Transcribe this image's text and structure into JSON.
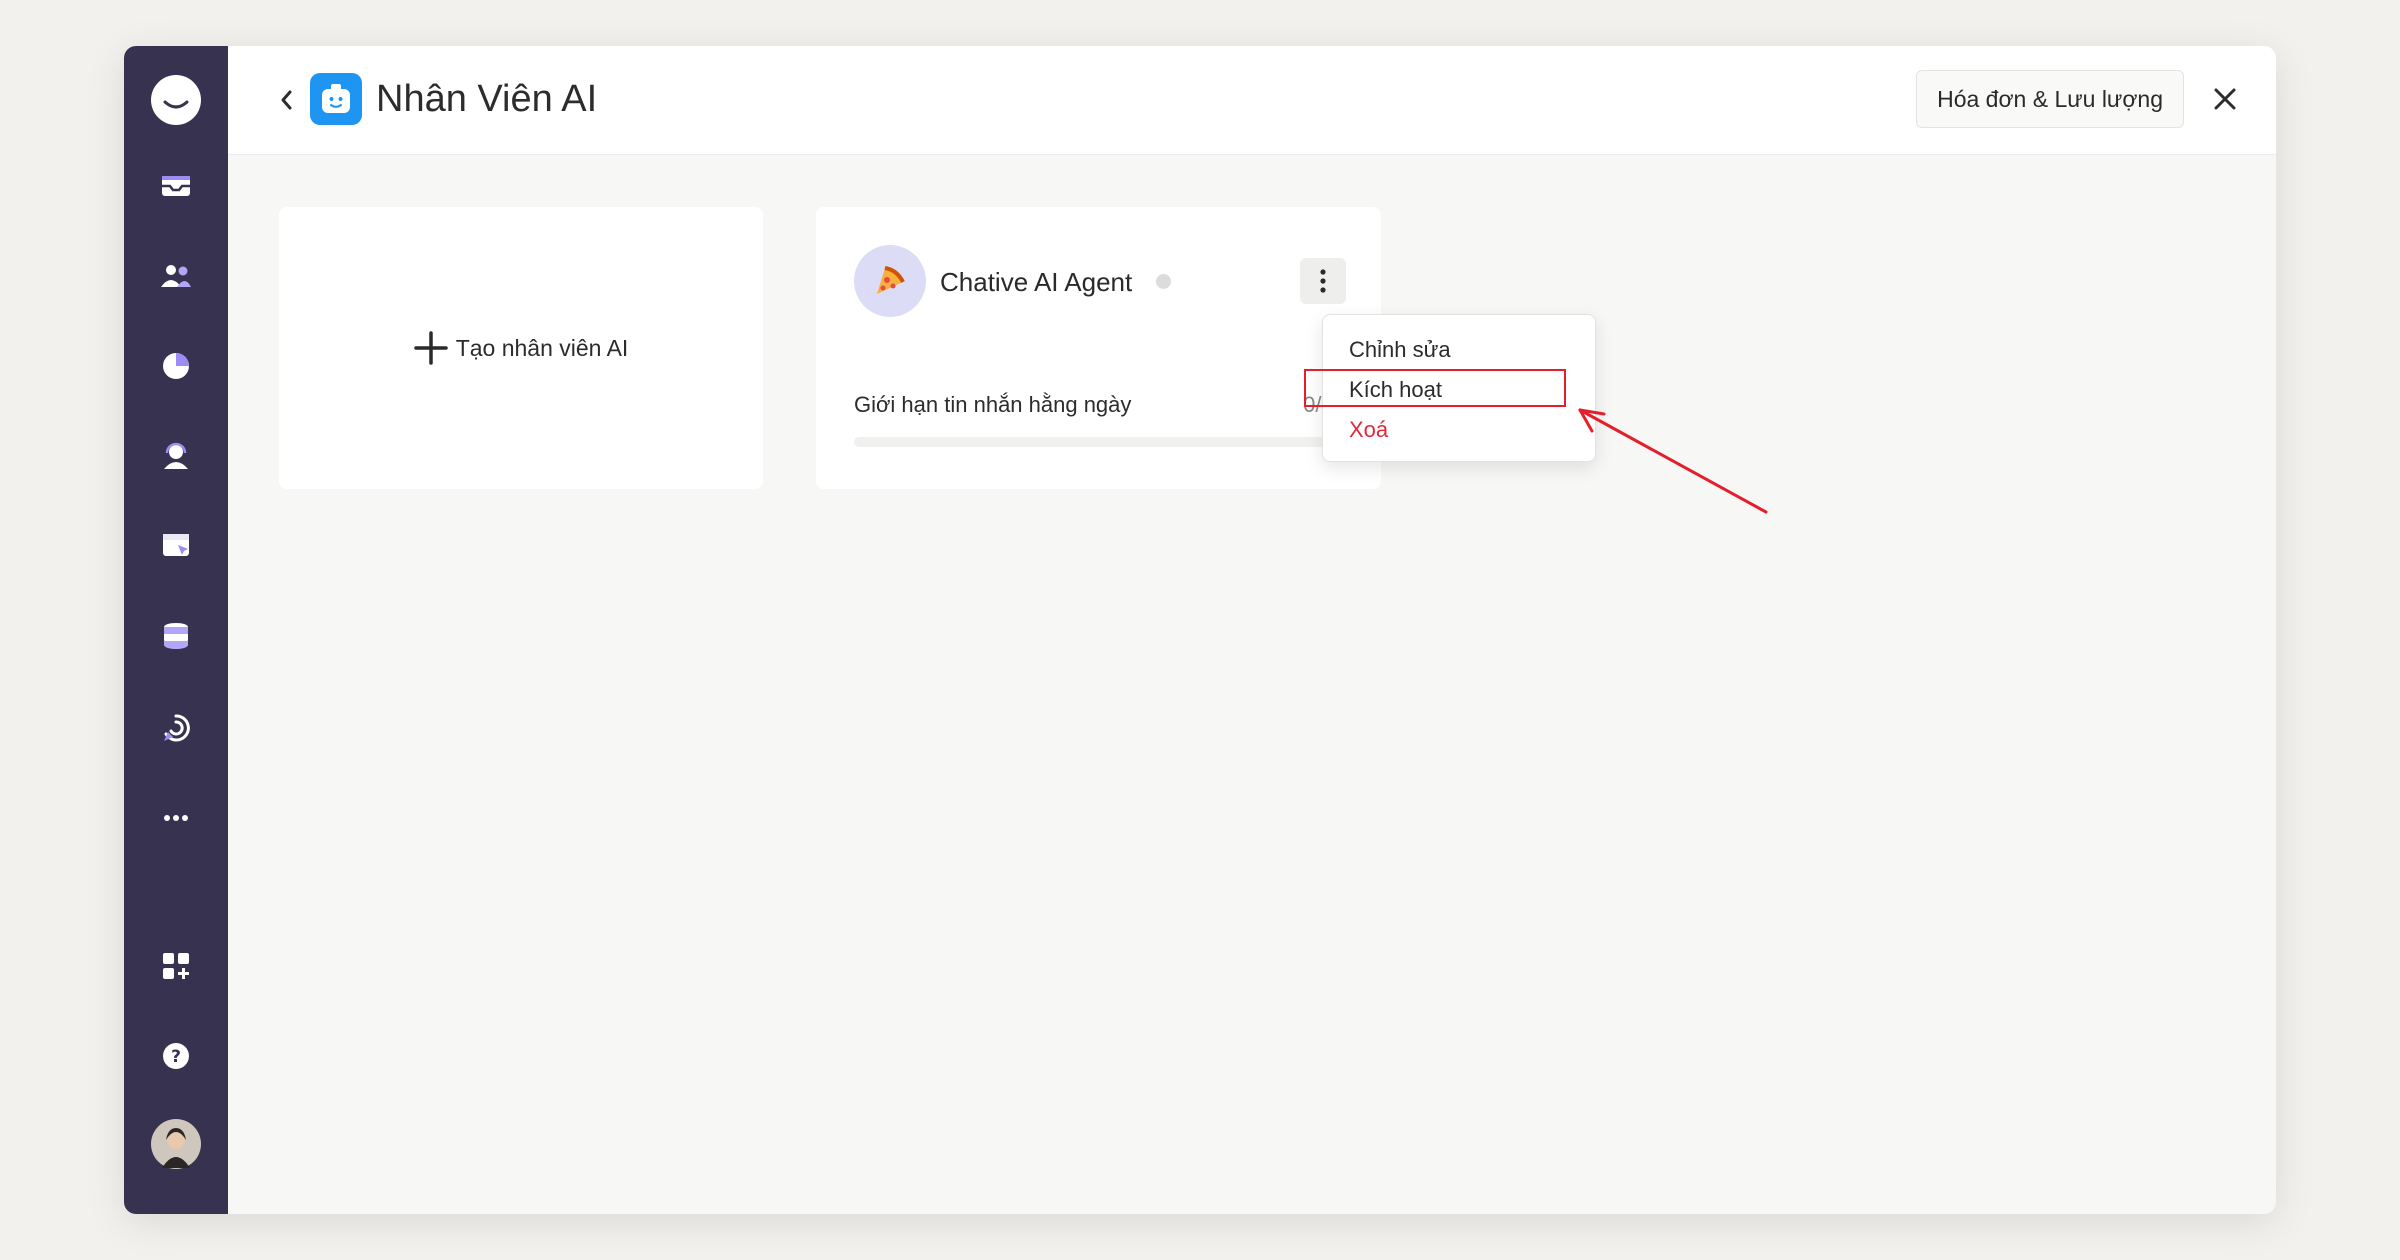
{
  "header": {
    "title": "Nhân Viên AI",
    "billing_button": "Hóa đơn & Lưu lượng"
  },
  "create_card": {
    "label": "Tạo nhân viên AI"
  },
  "agent_card": {
    "name": "Chative AI Agent",
    "status": "inactive",
    "limit_label": "Giới hạn tin nhắn hằng ngày",
    "limit_count_visible": "0/10",
    "usage_fraction": 0
  },
  "context_menu": {
    "items": [
      {
        "label": "Chỉnh sửa",
        "type": "default"
      },
      {
        "label": "Kích hoạt",
        "type": "default",
        "highlighted": true
      },
      {
        "label": "Xoá",
        "type": "danger"
      }
    ]
  },
  "sidebar": {
    "icons": [
      "chat-logo-icon",
      "inbox-icon",
      "contacts-icon",
      "reports-icon",
      "agents-icon",
      "widget-icon",
      "database-icon",
      "automation-icon",
      "more-icon",
      "apps-icon",
      "help-icon",
      "user-avatar"
    ]
  },
  "colors": {
    "sidebar_bg": "#36324f",
    "accent": "#1e95f2",
    "danger": "#e0283c",
    "annotation": "#e41e2b"
  }
}
